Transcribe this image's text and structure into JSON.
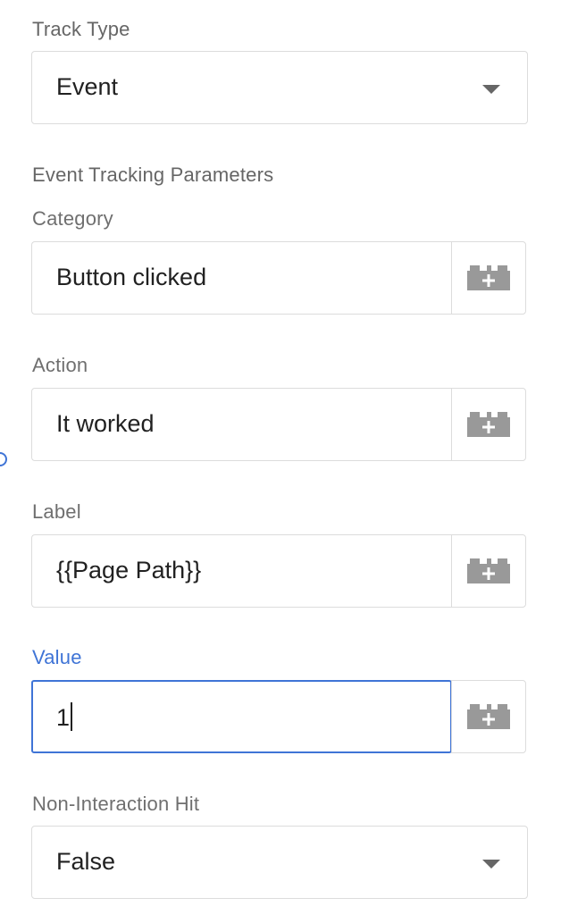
{
  "track_type": {
    "label": "Track Type",
    "selected": "Event",
    "caret_icon": "dropdown-arrow-icon"
  },
  "section_title": "Event Tracking Parameters",
  "fields": {
    "category": {
      "label": "Category",
      "value": "Button clicked",
      "icon": "variable-picker-icon"
    },
    "action": {
      "label": "Action",
      "value": "It worked",
      "icon": "variable-picker-icon"
    },
    "label": {
      "label": "Label",
      "value": "{{Page Path}}",
      "icon": "variable-picker-icon"
    },
    "value": {
      "label": "Value",
      "value": "1",
      "icon": "variable-picker-icon",
      "focused": true
    }
  },
  "non_interaction": {
    "label": "Non-Interaction Hit",
    "selected": "False",
    "caret_icon": "dropdown-arrow-icon"
  },
  "colors": {
    "accent": "#3f74d6",
    "label_text": "#6f6f6f",
    "value_text": "#212121",
    "border": "#dcdcdc",
    "icon": "#999999"
  }
}
